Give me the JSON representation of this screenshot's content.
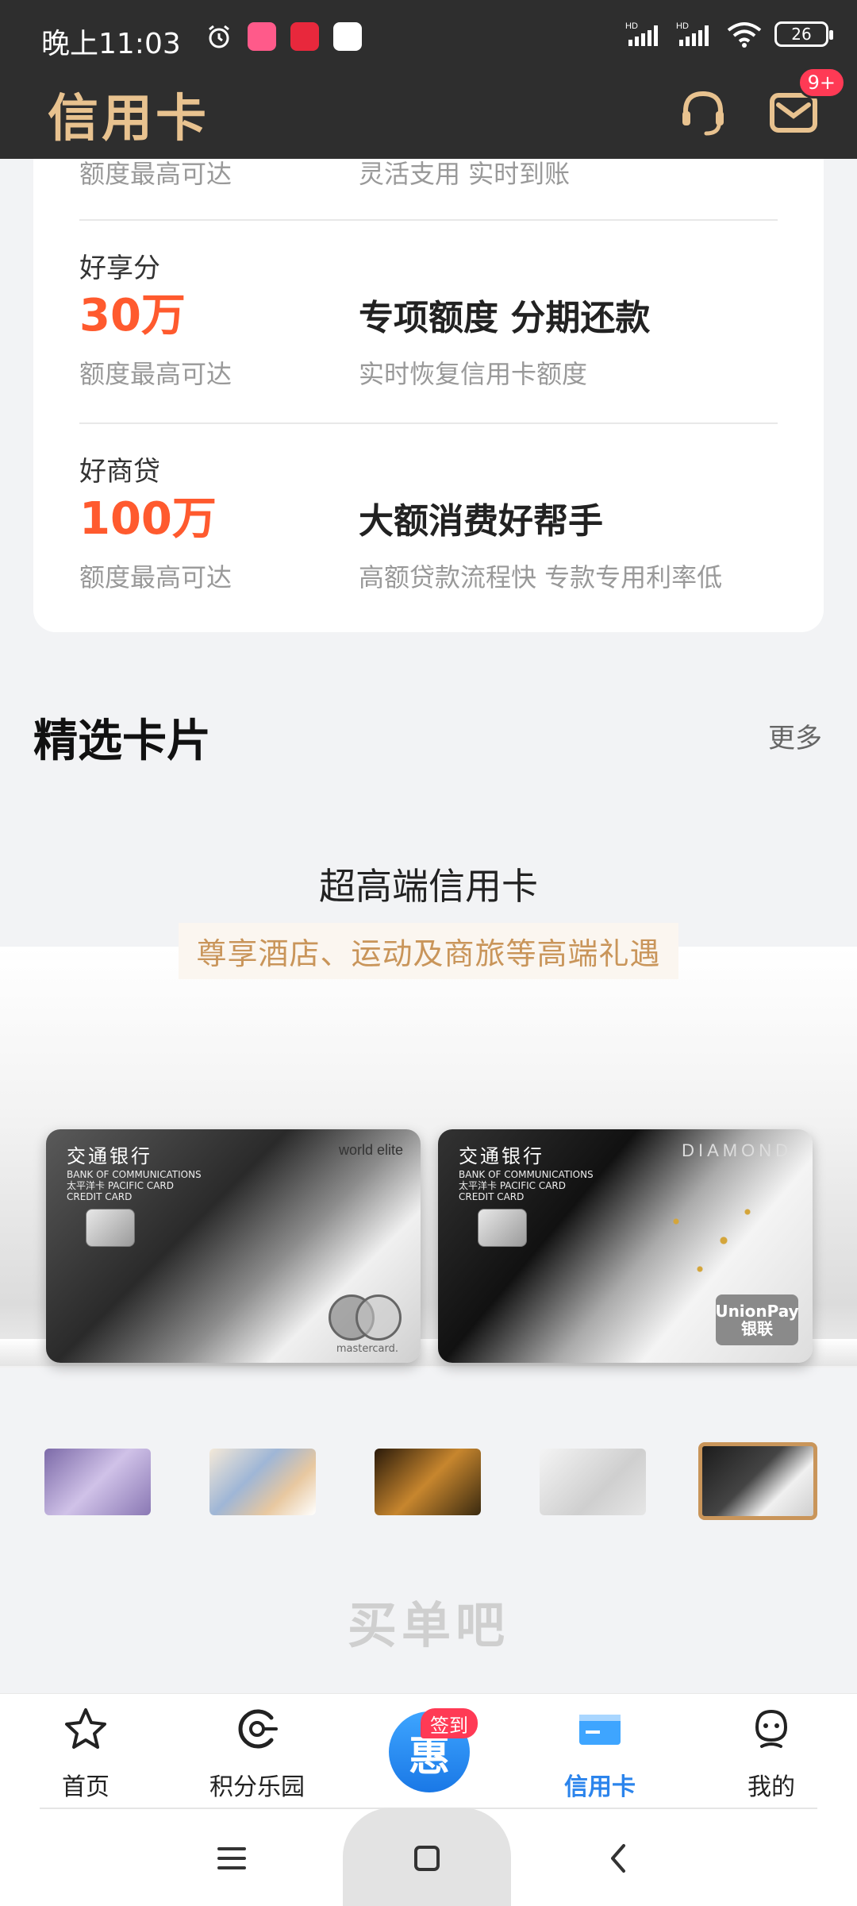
{
  "status_bar": {
    "time": "晚上11:03",
    "dots": "···",
    "battery": "26"
  },
  "header": {
    "title": "信用卡",
    "message_badge": "9+"
  },
  "loans": {
    "top_partial": {
      "sub": "额度最高可达",
      "desc": "灵活支用 实时到账"
    },
    "items": [
      {
        "name": "好享分",
        "amount": "30万",
        "sub": "额度最高可达",
        "feature": "专项额度 分期还款",
        "desc": "实时恢复信用卡额度"
      },
      {
        "name": "好商贷",
        "amount": "100万",
        "sub": "额度最高可达",
        "feature": "大额消费好帮手",
        "desc": "高额贷款流程快 专款专用利率低"
      }
    ]
  },
  "featured": {
    "title": "精选卡片",
    "more": "更多",
    "promo_title": "超高端信用卡",
    "promo_subtitle": "尊享酒店、运动及商旅等高端礼遇",
    "card_a": {
      "bank": "交通银行",
      "bank_en": "BANK OF COMMUNICATIONS",
      "line2": "太平洋卡 PACIFIC CARD",
      "line3": "CREDIT CARD",
      "tier": "world elite",
      "network": "mastercard."
    },
    "card_b": {
      "bank": "交通银行",
      "bank_en": "BANK OF COMMUNICATIONS",
      "line2": "太平洋卡 PACIFIC CARD",
      "line3": "CREDIT CARD",
      "tier": "DIAMOND",
      "network_line1": "UnionPay",
      "network_line2": "银联"
    },
    "selected_thumb_index": 4,
    "thumb_count": 5
  },
  "next_section_title": "买单吧",
  "bottom_nav": {
    "items": [
      {
        "label": "首页",
        "icon": "star-icon"
      },
      {
        "label": "积分乐园",
        "icon": "points-icon"
      },
      {
        "label": "",
        "icon": "checkin-icon"
      },
      {
        "label": "信用卡",
        "icon": "credit-card-icon"
      },
      {
        "label": "我的",
        "icon": "profile-icon"
      }
    ],
    "center_glyph": "惠",
    "center_badge": "签到",
    "active_index": 3
  },
  "colors": {
    "accent_gold": "#e8c28f",
    "amount_orange": "#ff5a2e",
    "nav_active": "#2b84ec",
    "badge_red": "#ff3a55",
    "header_bg": "#2e2e2e"
  }
}
